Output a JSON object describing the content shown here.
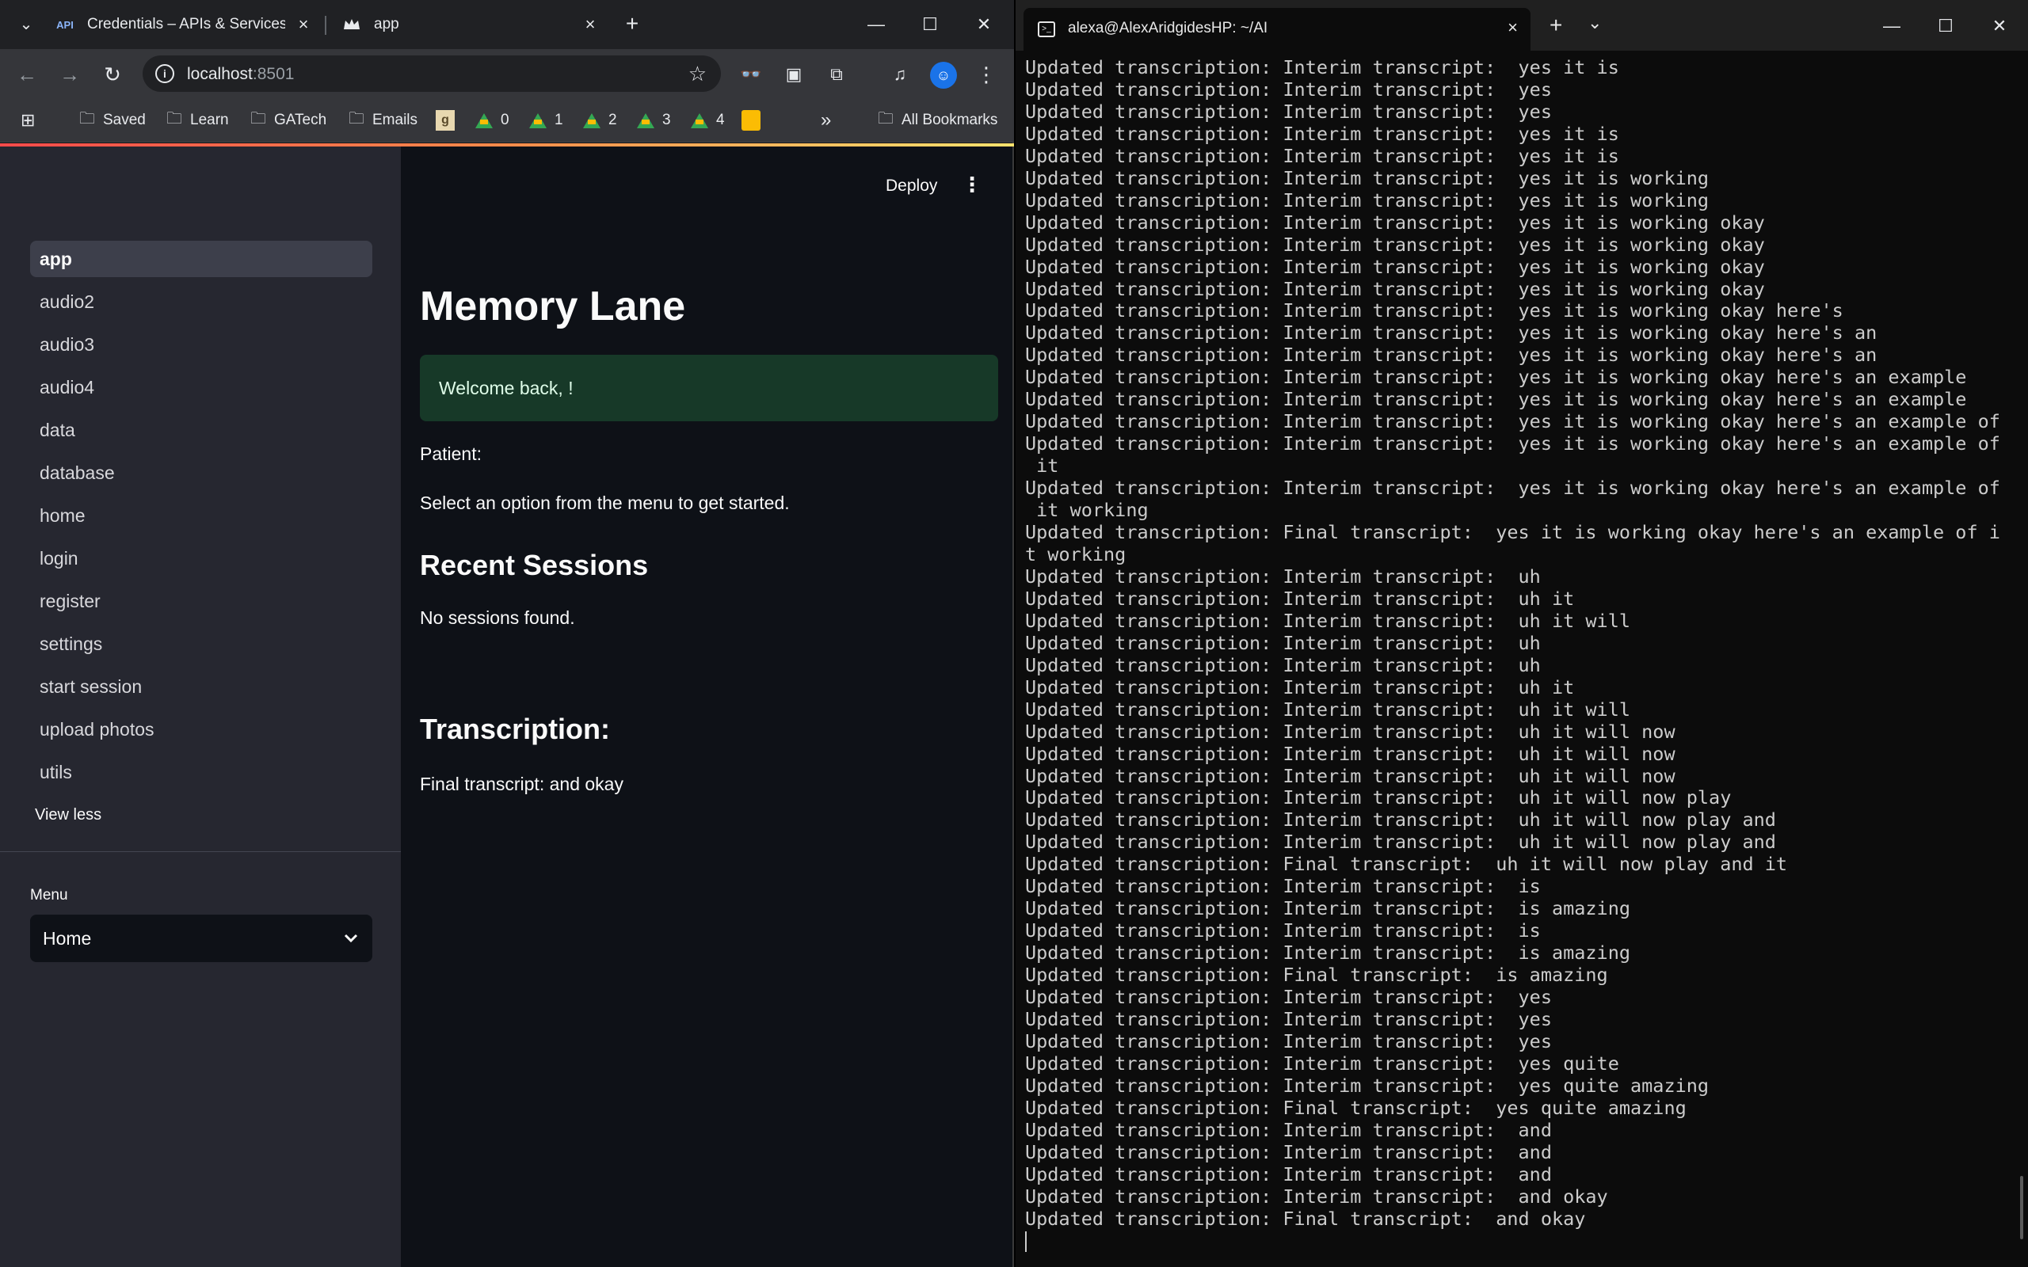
{
  "browser": {
    "tabs": [
      {
        "favicon": "API",
        "title": "Credentials – APIs & Services –"
      },
      {
        "favicon": "crown-icon",
        "title": "app"
      }
    ],
    "url_host": "localhost",
    "url_port": ":8501",
    "bookmarks": [
      {
        "icon": "folder-icon",
        "label": "Saved"
      },
      {
        "icon": "folder-icon",
        "label": "Learn"
      },
      {
        "icon": "folder-icon",
        "label": "GATech"
      },
      {
        "icon": "folder-icon",
        "label": "Emails"
      },
      {
        "icon": "goodreads-icon",
        "label": "g"
      },
      {
        "icon": "drive-icon",
        "label": "0"
      },
      {
        "icon": "drive-icon",
        "label": "1"
      },
      {
        "icon": "drive-icon",
        "label": "2"
      },
      {
        "icon": "drive-icon",
        "label": "3"
      },
      {
        "icon": "drive-icon",
        "label": "4"
      },
      {
        "icon": "keep-icon",
        "label": ""
      }
    ],
    "more_bookmarks": "»",
    "all_bookmarks": "All Bookmarks"
  },
  "app": {
    "sidebar_pages": [
      "app",
      "audio2",
      "audio3",
      "audio4",
      "data",
      "database",
      "home",
      "login",
      "register",
      "settings",
      "start session",
      "upload photos",
      "utils"
    ],
    "active_page": "app",
    "view_less": "View less",
    "menu_label": "Menu",
    "menu_selected": "Home",
    "deploy": "Deploy",
    "title": "Memory Lane",
    "welcome": "Welcome back, !",
    "patient": "Patient:",
    "prompt": "Select an option from the menu to get started.",
    "recent_sessions": "Recent Sessions",
    "no_sessions": "No sessions found.",
    "transcription_heading": "Transcription:",
    "final_transcript": "Final transcript: and okay"
  },
  "terminal": {
    "tab_title": "alexa@AlexAridgidesHP: ~/AI",
    "lines": [
      "Updated transcription: Interim transcript:  yes it is",
      "Updated transcription: Interim transcript:  yes",
      "Updated transcription: Interim transcript:  yes",
      "Updated transcription: Interim transcript:  yes it is",
      "Updated transcription: Interim transcript:  yes it is",
      "Updated transcription: Interim transcript:  yes it is working",
      "Updated transcription: Interim transcript:  yes it is working",
      "Updated transcription: Interim transcript:  yes it is working okay",
      "Updated transcription: Interim transcript:  yes it is working okay",
      "Updated transcription: Interim transcript:  yes it is working okay",
      "Updated transcription: Interim transcript:  yes it is working okay",
      "Updated transcription: Interim transcript:  yes it is working okay here's",
      "Updated transcription: Interim transcript:  yes it is working okay here's an",
      "Updated transcription: Interim transcript:  yes it is working okay here's an",
      "Updated transcription: Interim transcript:  yes it is working okay here's an example",
      "Updated transcription: Interim transcript:  yes it is working okay here's an example",
      "Updated transcription: Interim transcript:  yes it is working okay here's an example of",
      "Updated transcription: Interim transcript:  yes it is working okay here's an example of",
      " it",
      "Updated transcription: Interim transcript:  yes it is working okay here's an example of",
      " it working",
      "Updated transcription: Final transcript:  yes it is working okay here's an example of i",
      "t working",
      "Updated transcription: Interim transcript:  uh",
      "Updated transcription: Interim transcript:  uh it",
      "Updated transcription: Interim transcript:  uh it will",
      "Updated transcription: Interim transcript:  uh",
      "Updated transcription: Interim transcript:  uh",
      "Updated transcription: Interim transcript:  uh it",
      "Updated transcription: Interim transcript:  uh it will",
      "Updated transcription: Interim transcript:  uh it will now",
      "Updated transcription: Interim transcript:  uh it will now",
      "Updated transcription: Interim transcript:  uh it will now",
      "Updated transcription: Interim transcript:  uh it will now play",
      "Updated transcription: Interim transcript:  uh it will now play and",
      "Updated transcription: Interim transcript:  uh it will now play and",
      "Updated transcription: Final transcript:  uh it will now play and it",
      "Updated transcription: Interim transcript:  is",
      "Updated transcription: Interim transcript:  is amazing",
      "Updated transcription: Interim transcript:  is",
      "Updated transcription: Interim transcript:  is amazing",
      "Updated transcription: Final transcript:  is amazing",
      "Updated transcription: Interim transcript:  yes",
      "Updated transcription: Interim transcript:  yes",
      "Updated transcription: Interim transcript:  yes",
      "Updated transcription: Interim transcript:  yes quite",
      "Updated transcription: Interim transcript:  yes quite amazing",
      "Updated transcription: Final transcript:  yes quite amazing",
      "Updated transcription: Interim transcript:  and",
      "Updated transcription: Interim transcript:  and",
      "Updated transcription: Interim transcript:  and",
      "Updated transcription: Interim transcript:  and okay",
      "Updated transcription: Final transcript:  and okay"
    ]
  },
  "colors": {
    "streamlit_bg": "#0e1117",
    "sidebar_bg": "#262730",
    "success_bg": "#173928",
    "terminal_bg": "#0c0c0c",
    "chrome_toolbar": "#35363a"
  }
}
